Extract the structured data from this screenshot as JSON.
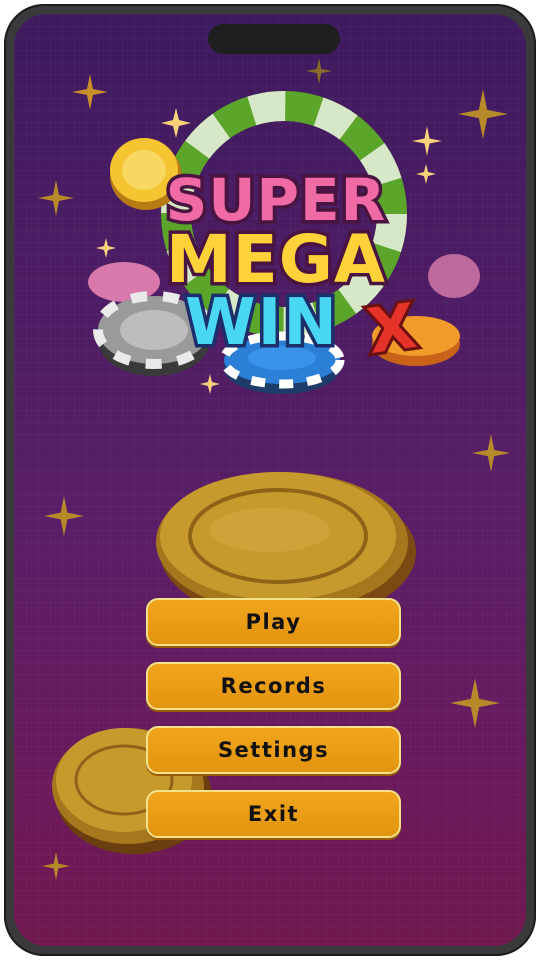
{
  "logo": {
    "line1": "SUPER",
    "line2": "MEGA",
    "line3": "WIN",
    "mark": "X",
    "colors": {
      "super": "#f06aa6",
      "mega": "#ffd23a",
      "win": "#4ad7f3",
      "x": "#e5332a"
    }
  },
  "menu": {
    "play": "Play",
    "records": "Records",
    "settings": "Settings",
    "exit": "Exit"
  },
  "colors": {
    "background_top": "#3e1a5e",
    "background_bottom": "#71184f",
    "button": "#ec9e16",
    "button_border": "#f3e28a"
  },
  "icons": [
    "sparkle-icon",
    "gold-coin-icon",
    "poker-chip-icon"
  ]
}
